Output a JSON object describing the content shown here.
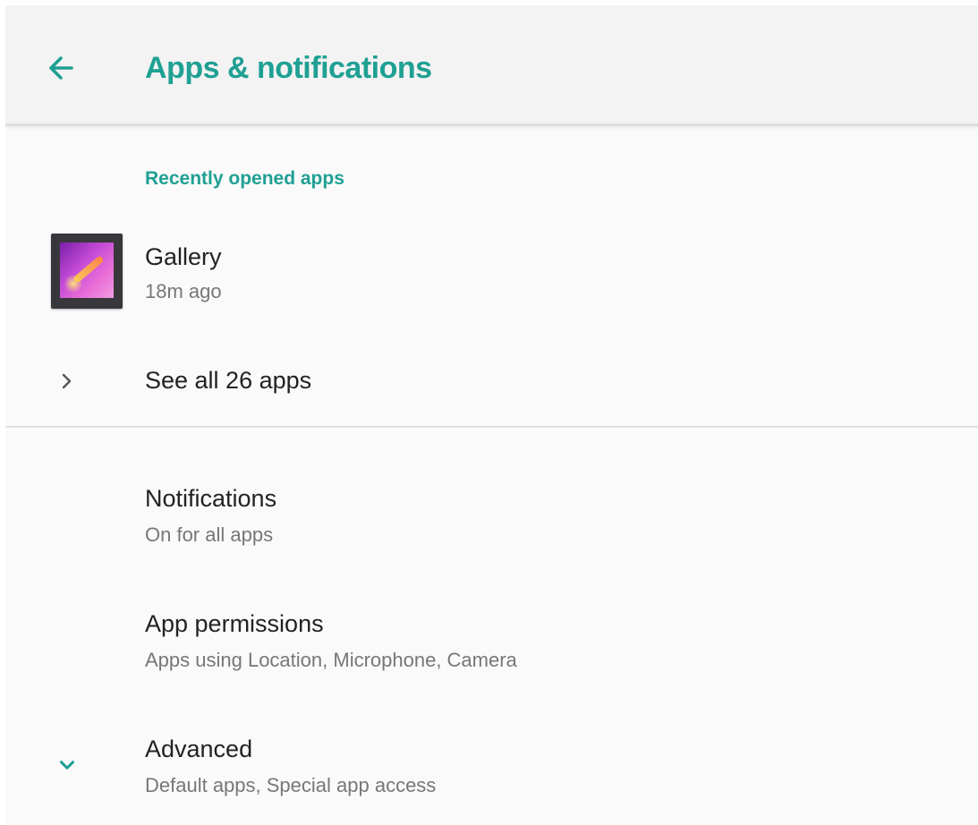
{
  "appbar": {
    "title": "Apps & notifications",
    "back_icon": "arrow-back-icon"
  },
  "recent": {
    "header": "Recently opened apps",
    "apps": [
      {
        "name": "Gallery",
        "time": "18m ago",
        "icon": "gallery-app-icon"
      }
    ],
    "see_all_label": "See all 26 apps"
  },
  "settings": {
    "notifications": {
      "title": "Notifications",
      "summary": "On for all apps"
    },
    "permissions": {
      "title": "App permissions",
      "summary": "Apps using Location, Microphone, Camera"
    },
    "advanced": {
      "title": "Advanced",
      "summary": "Default apps, Special app access"
    }
  },
  "colors": {
    "accent": "#1fa093",
    "background": "#fafafa",
    "appbar": "#f3f3f3",
    "primary_text": "#222222",
    "secondary_text": "#777777"
  }
}
